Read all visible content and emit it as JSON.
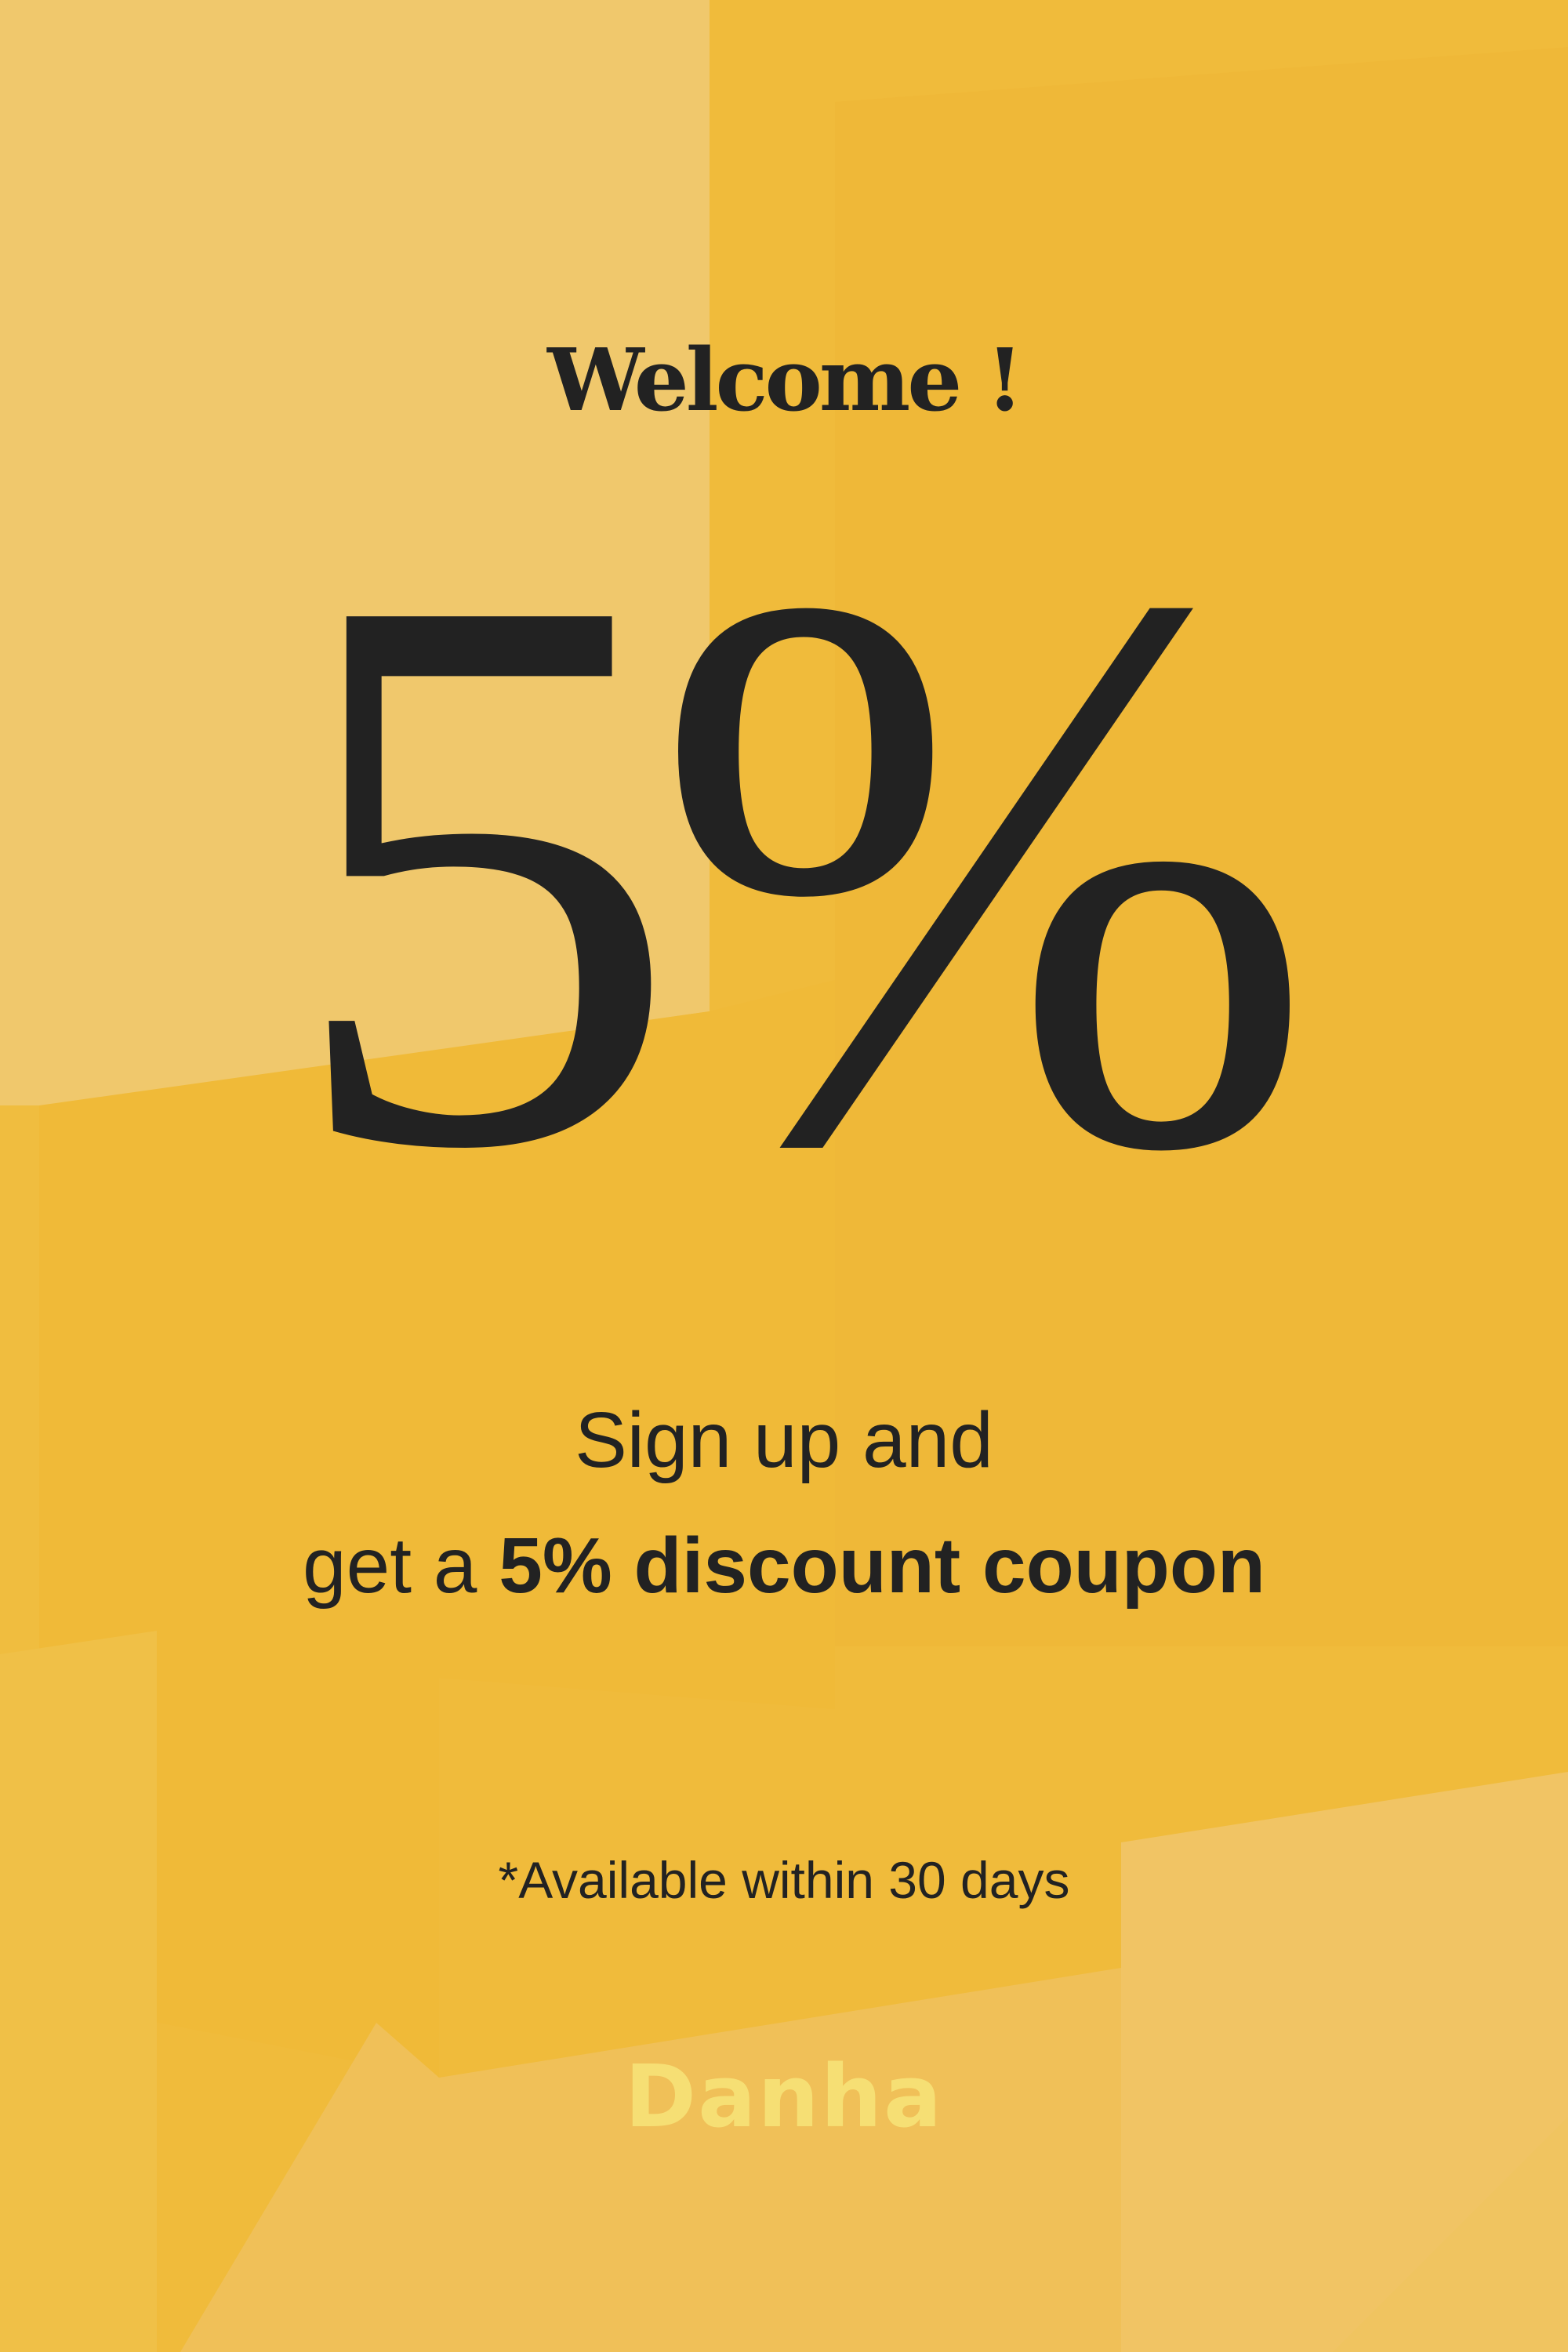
{
  "headline": "Welcome !",
  "offer": {
    "big_value": "5%"
  },
  "message": {
    "line1": "Sign up and",
    "line2_prefix": "get a ",
    "line2_bold": "5% discount coupon"
  },
  "note": "*Available within 30 days",
  "brand": "Danha",
  "colors": {
    "background": "#f0bb3b",
    "text": "#222222",
    "brand": "#f6df74"
  }
}
